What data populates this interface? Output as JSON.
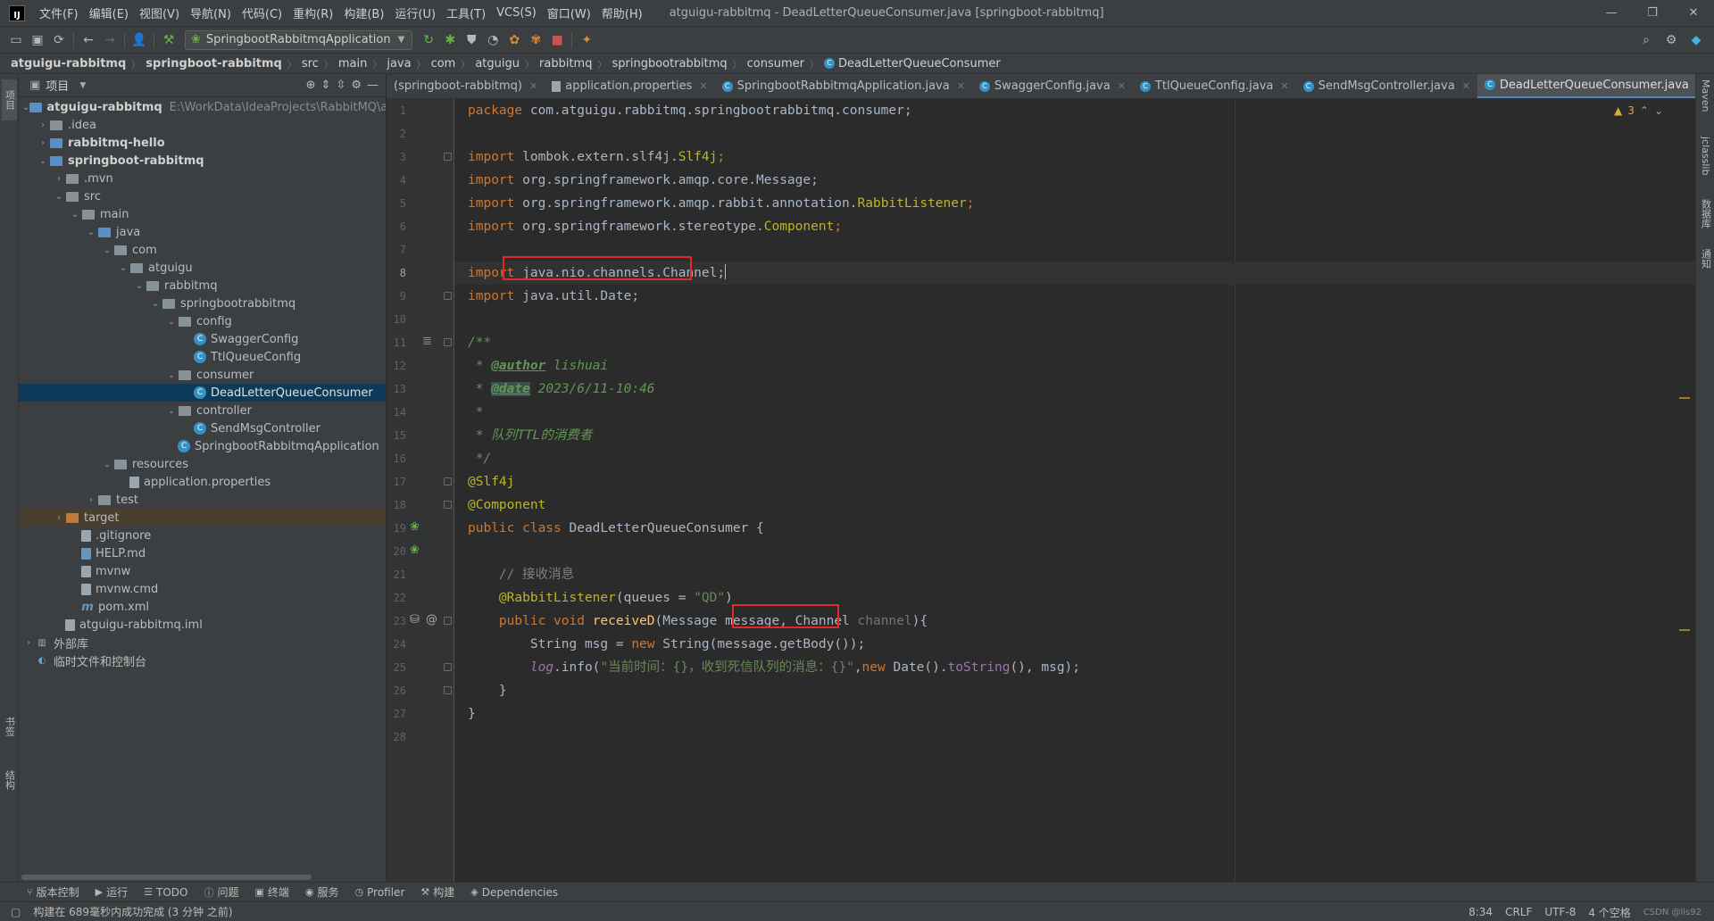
{
  "menubar": {
    "items": [
      "文件(F)",
      "编辑(E)",
      "视图(V)",
      "导航(N)",
      "代码(C)",
      "重构(R)",
      "构建(B)",
      "运行(U)",
      "工具(T)",
      "VCS(S)",
      "窗口(W)",
      "帮助(H)"
    ],
    "window_title": "atguigu-rabbitmq - DeadLetterQueueConsumer.java [springboot-rabbitmq]"
  },
  "toolbar": {
    "run_config": "SpringbootRabbitmqApplication"
  },
  "breadcrumb": [
    "atguigu-rabbitmq",
    "springboot-rabbitmq",
    "src",
    "main",
    "java",
    "com",
    "atguigu",
    "rabbitmq",
    "springbootrabbitmq",
    "consumer",
    "DeadLetterQueueConsumer"
  ],
  "project_panel": {
    "title": "项目",
    "stripe_project": "项目",
    "stripe_bookmarks": "书签",
    "stripe_structure": "结构",
    "tree": [
      {
        "label": "atguigu-rabbitmq",
        "path": "E:\\WorkData\\IdeaProjects\\RabbitMQ\\at"
      },
      {
        "label": ".idea"
      },
      {
        "label": "rabbitmq-hello"
      },
      {
        "label": "springboot-rabbitmq"
      },
      {
        "label": ".mvn"
      },
      {
        "label": "src"
      },
      {
        "label": "main"
      },
      {
        "label": "java"
      },
      {
        "label": "com"
      },
      {
        "label": "atguigu"
      },
      {
        "label": "rabbitmq"
      },
      {
        "label": "springbootrabbitmq"
      },
      {
        "label": "config"
      },
      {
        "label": "SwaggerConfig"
      },
      {
        "label": "TtlQueueConfig"
      },
      {
        "label": "consumer"
      },
      {
        "label": "DeadLetterQueueConsumer"
      },
      {
        "label": "controller"
      },
      {
        "label": "SendMsgController"
      },
      {
        "label": "SpringbootRabbitmqApplication"
      },
      {
        "label": "resources"
      },
      {
        "label": "application.properties"
      },
      {
        "label": "test"
      },
      {
        "label": "target"
      },
      {
        "label": ".gitignore"
      },
      {
        "label": "HELP.md"
      },
      {
        "label": "mvnw"
      },
      {
        "label": "mvnw.cmd"
      },
      {
        "label": "pom.xml"
      },
      {
        "label": "atguigu-rabbitmq.iml"
      },
      {
        "label": "外部库"
      },
      {
        "label": "临时文件和控制台"
      }
    ]
  },
  "editor_tabs": [
    {
      "label": "(springboot-rabbitmq)"
    },
    {
      "label": "application.properties"
    },
    {
      "label": "SpringbootRabbitmqApplication.java"
    },
    {
      "label": "SwaggerConfig.java"
    },
    {
      "label": "TtlQueueConfig.java"
    },
    {
      "label": "SendMsgController.java"
    },
    {
      "label": "DeadLetterQueueConsumer.java"
    }
  ],
  "editor": {
    "warning_count": "3",
    "line_numbers": [
      "1",
      "2",
      "3",
      "4",
      "5",
      "6",
      "7",
      "8",
      "9",
      "10",
      "11",
      "12",
      "13",
      "14",
      "15",
      "16",
      "17",
      "18",
      "19",
      "20",
      "21",
      "22",
      "23",
      "24",
      "25",
      "26",
      "27",
      "28"
    ],
    "code": {
      "l1_kw": "package",
      "l1_rest": " com.atguigu.rabbitmq.springbootrabbitmq.consumer;",
      "l3_kw": "import",
      "l3_a": " lombok.extern.slf4j.",
      "l3_b": "Slf4j",
      "l3_c": ";",
      "l4_kw": "import",
      "l4_rest": " org.springframework.amqp.core.Message;",
      "l5_kw": "import",
      "l5_a": " org.springframework.amqp.rabbit.annotation.",
      "l5_b": "RabbitListener",
      "l5_c": ";",
      "l6_kw": "import",
      "l6_a": " org.springframework.stereotype.",
      "l6_b": "Component",
      "l6_c": ";",
      "l8_kw": "import",
      "l8_rest": " java.nio.channels.Channel;",
      "l9_kw": "import",
      "l9_rest": " java.util.Date;",
      "l11": "/**",
      "l12_pre": " * ",
      "l12_tag": "@author",
      "l12_rest": " lishuai",
      "l13_pre": " * ",
      "l13_tag": "@date",
      "l13_rest": " 2023/6/11-10:46",
      "l14": " *",
      "l15": " * 队列TTL的消费者",
      "l16": " */",
      "l17": "@Slf4j",
      "l18": "@Component",
      "l19_kw": "public class",
      "l19_rest": " DeadLetterQueueConsumer {",
      "l21": "    // 接收消息",
      "l22_ann": "    @RabbitListener",
      "l22_a": "(queues = ",
      "l22_str": "\"QD\"",
      "l22_b": ")",
      "l23_kw": "    public void ",
      "l23_fn": "receiveD",
      "l23_a": "(Message message, ",
      "l23_type": "Channel ",
      "l23_param": "channel",
      "l23_b": "){",
      "l24_a": "        String msg = ",
      "l24_kw": "new",
      "l24_b": " String(message.getBody());",
      "l25_field": "        log",
      "l25_a": ".info(",
      "l25_str": "\"当前时间：{}，收到死信队列的消息：{}\"",
      "l25_b": ",",
      "l25_kw": "new",
      "l25_c": " Date().",
      "l25_tostr": "toString",
      "l25_d": "(), msg);",
      "l26": "    }",
      "l27": "}"
    }
  },
  "bottom_tools": [
    "版本控制",
    "运行",
    "TODO",
    "问题",
    "终端",
    "服务",
    "Profiler",
    "构建",
    "Dependencies"
  ],
  "status": {
    "message": "构建在 689毫秒内成功完成 (3 分钟 之前)",
    "position": "8:34",
    "line_sep": "CRLF",
    "encoding": "UTF-8",
    "indent": "4 个空格",
    "watermark": "CSDN @lis92"
  },
  "right_stripe": [
    "Maven",
    "jclasslib",
    "数据库",
    "通知"
  ]
}
